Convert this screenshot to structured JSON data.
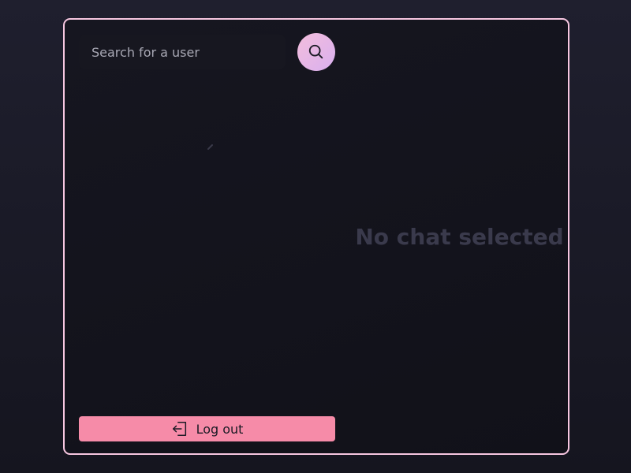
{
  "search": {
    "placeholder": "Search for a user",
    "value": "",
    "button_icon": "search-icon"
  },
  "sidebar": {
    "logout_label": "Log out",
    "logout_icon": "logout-icon"
  },
  "chat": {
    "empty_title": "No chat selected"
  },
  "colors": {
    "frame_border": "#f6c6e0",
    "logout_button": "#f68ba8",
    "search_button_start": "#f3bddc",
    "search_button_end": "#d9b0ef",
    "empty_title": "#3a3a4c"
  }
}
